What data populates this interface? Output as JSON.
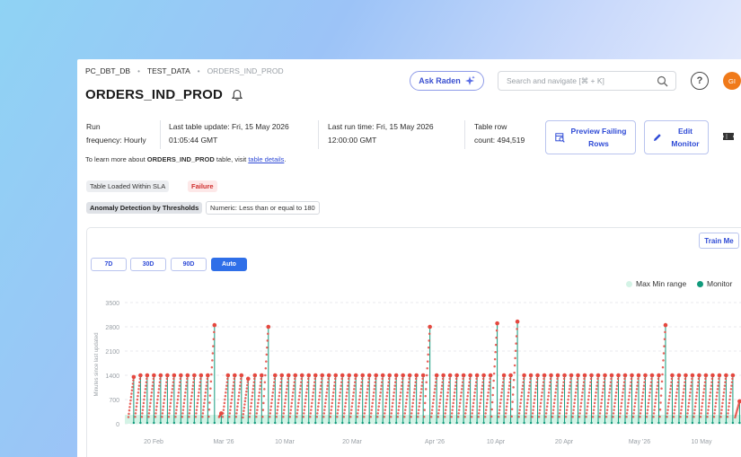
{
  "breadcrumb": {
    "items": [
      "PC_DBT_DB",
      "TEST_DATA",
      "ORDERS_IND_PROD"
    ]
  },
  "page": {
    "title": "ORDERS_IND_PROD"
  },
  "header": {
    "ask_label": "Ask Raden",
    "search_placeholder": "Search and navigate [⌘ + K]",
    "help_label": "?",
    "avatar_initials": "GI"
  },
  "meta": {
    "run_frequency_1": "Run",
    "run_frequency_2": "frequency: Hourly",
    "last_update_1": "Last table update: Fri, 15 May 2026",
    "last_update_2": "01:05:44 GMT",
    "last_run_1": "Last run time: Fri, 15 May 2026",
    "last_run_2": "12:00:00 GMT",
    "row_count_1": "Table row",
    "row_count_2": "count: 494,519"
  },
  "actions": {
    "preview_1": "Preview Failing",
    "preview_2": "Rows",
    "edit_1": "Edit",
    "edit_2": "Monitor"
  },
  "info": {
    "prefix": "To learn more about ",
    "table": "ORDERS_IND_PROD",
    "middle": " table, visit ",
    "link": "table details",
    "suffix": "."
  },
  "tags": {
    "check": "Table Loaded Within SLA",
    "status": "Failure",
    "method": "Anomaly Detection by Thresholds",
    "rule": "Numeric: Less than or equal to 180"
  },
  "chart_controls": {
    "train_label": "Train Me",
    "ranges": [
      "7D",
      "30D",
      "90D",
      "Auto"
    ],
    "active_range": "Auto"
  },
  "colors": {
    "accent": "#2f4bd6",
    "failure": "#e5483f",
    "monitor": "#119a7c",
    "range_band": "#d4f3e6"
  },
  "chart_data": {
    "type": "line",
    "ylabel": "Minutes since last updated",
    "yticks": [
      0,
      700,
      1400,
      2100,
      2800,
      3500
    ],
    "ylim": [
      0,
      3500
    ],
    "xticks": [
      "20 Feb",
      "Mar '26",
      "10 Mar",
      "20 Mar",
      "Apr '26",
      "10 Apr",
      "20 Apr",
      "May '26",
      "10 May"
    ],
    "legend": [
      {
        "name": "Max Min range",
        "color": "#d4f3e6"
      },
      {
        "name": "Monitor",
        "color": "#119a7c"
      }
    ],
    "legend_position": "top-right",
    "grid": true,
    "series": [
      {
        "name": "Monitor",
        "description_free": true,
        "daily_peaks": [
          1350,
          1400,
          1400,
          1400,
          1400,
          1400,
          1400,
          1400,
          1400,
          1400,
          1400,
          1400,
          2850,
          300,
          1400,
          1400,
          1400,
          1300,
          1400,
          1400,
          2800,
          1400,
          1400,
          1400,
          1400,
          1400,
          1400,
          1400,
          1400,
          1400,
          1400,
          1400,
          1400,
          1400,
          1400,
          1400,
          1400,
          1400,
          1400,
          1400,
          1400,
          1400,
          1400,
          1400,
          2800,
          1400,
          1400,
          1400,
          1400,
          1400,
          1400,
          1400,
          1400,
          1400,
          2900,
          1400,
          1400,
          2950,
          1400,
          1400,
          1400,
          1400,
          1400,
          1400,
          1400,
          1400,
          1400,
          1400,
          1400,
          1400,
          1400,
          1400,
          1400,
          1400,
          1400,
          1400,
          1400,
          1400,
          1400,
          2850,
          1400,
          1400,
          1400,
          1400,
          1400,
          1400,
          1400,
          1400,
          1400,
          1400,
          650
        ],
        "range_max": 180
      }
    ]
  }
}
